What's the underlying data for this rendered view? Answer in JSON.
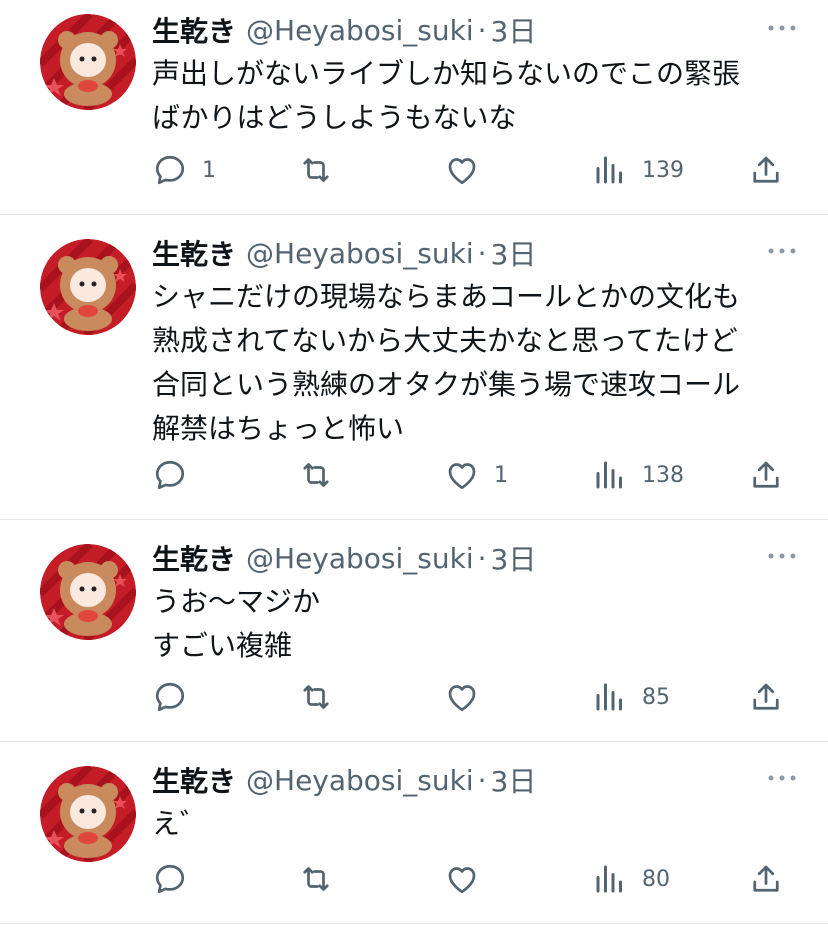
{
  "colors": {
    "text": "#0f1419",
    "secondary": "#536471",
    "divider": "#e6e9eb",
    "avatar_bg": "#c51d28"
  },
  "icons": {
    "reply": "reply-icon",
    "retweet": "retweet-icon",
    "like": "heart-icon",
    "views": "views-icon",
    "share": "share-icon",
    "more": "more-icon"
  },
  "tweets": [
    {
      "name": "生乾き",
      "handle": "@Heyabosi_suki",
      "dot": "·",
      "time": "3日",
      "lines": [
        "声出しがないライブしか知らないのでこの緊張",
        "ばかりはどうしようもないな"
      ],
      "replies": "1",
      "retweets": "",
      "likes": "",
      "views": "139"
    },
    {
      "name": "生乾き",
      "handle": "@Heyabosi_suki",
      "dot": "·",
      "time": "3日",
      "lines": [
        "シャニだけの現場ならまあコールとかの文化も",
        "熟成されてないから大丈夫かなと思ってたけど",
        "合同という熟練のオタクが集う場で速攻コール",
        "解禁はちょっと怖い"
      ],
      "replies": "",
      "retweets": "",
      "likes": "1",
      "views": "138"
    },
    {
      "name": "生乾き",
      "handle": "@Heyabosi_suki",
      "dot": "·",
      "time": "3日",
      "lines": [
        "うお〜マジか",
        "すごい複雑"
      ],
      "replies": "",
      "retweets": "",
      "likes": "",
      "views": "85"
    },
    {
      "name": "生乾き",
      "handle": "@Heyabosi_suki",
      "dot": "·",
      "time": "3日",
      "lines": [
        "え゛"
      ],
      "replies": "",
      "retweets": "",
      "likes": "",
      "views": "80"
    }
  ]
}
